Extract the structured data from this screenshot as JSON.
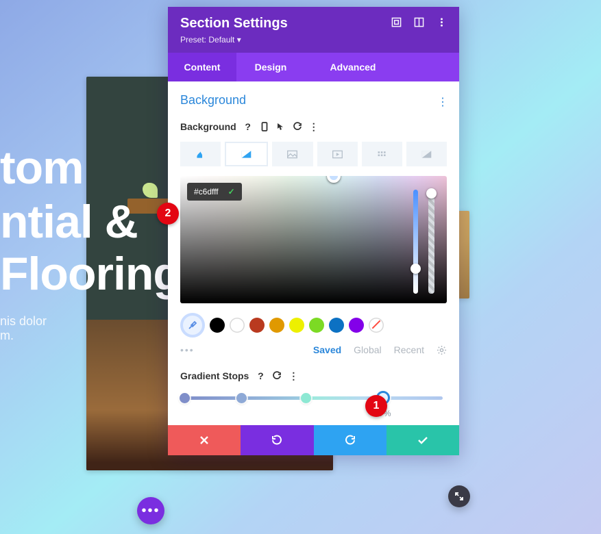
{
  "hero": {
    "line1": "tom",
    "line2": "ntial &",
    "line3": "Flooring",
    "sub1": "nis dolor",
    "sub2": "m."
  },
  "modal": {
    "title": "Section Settings",
    "preset_label": "Preset: Default",
    "tabs": {
      "content": "Content",
      "design": "Design",
      "advanced": "Advanced"
    },
    "section": "Background",
    "field_label": "Background",
    "hex_value": "#c6dfff",
    "palette": {
      "saved": "Saved",
      "global": "Global",
      "recent": "Recent"
    },
    "swatch_colors": [
      "#000000",
      "#ffffff",
      "#b93a1f",
      "#e09900",
      "#edf000",
      "#7cda24",
      "#0c71c3",
      "#8300e9"
    ],
    "gradient": {
      "label": "Gradient Stops",
      "selected_pct": "77%",
      "stops": [
        {
          "pos": 0,
          "color": "#7f8ec9"
        },
        {
          "pos": 22,
          "color": "#8ea9d6"
        },
        {
          "pos": 47,
          "color": "#8de8d3"
        },
        {
          "pos": 77,
          "color": "#b9daf2",
          "selected": true
        }
      ]
    }
  },
  "annotations": {
    "one": "1",
    "two": "2"
  }
}
